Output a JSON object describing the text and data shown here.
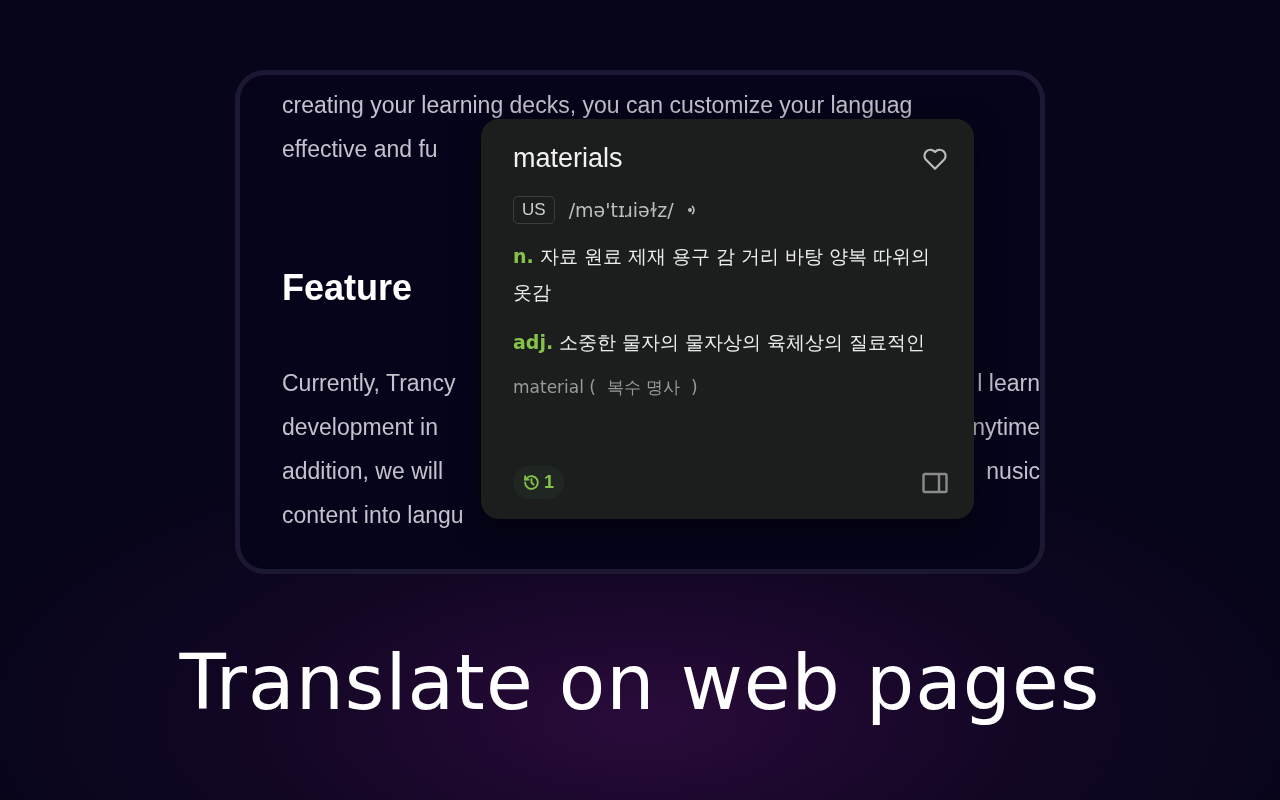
{
  "article": {
    "lines_top": [
      {
        "left": "creating your learning decks, you can customize your languag"
      },
      {
        "left": "effective and fu"
      }
    ],
    "heading": "Feature",
    "lines_bottom": [
      {
        "left": "Currently, Trancy",
        "right": "l learn"
      },
      {
        "left": "development in",
        "right": "nytime"
      },
      {
        "left": "addition, we will",
        "right": "nusic"
      },
      {
        "left": "content into langu"
      }
    ]
  },
  "popup": {
    "word": "materials",
    "favorited": false,
    "accent": "US",
    "phonetic": "/mə'tɪɹiəɫz/",
    "definitions": [
      {
        "pos": "n.",
        "text": "자료 원료 제재 용구 감 거리 바탕 양복 따위의 옷감"
      },
      {
        "pos": "adj.",
        "text": "소중한 물자의 물자상의 육체상의 질료적인"
      }
    ],
    "form": "material (  복수 명사  )",
    "history_count": "1"
  },
  "caption": "Translate on web pages"
}
